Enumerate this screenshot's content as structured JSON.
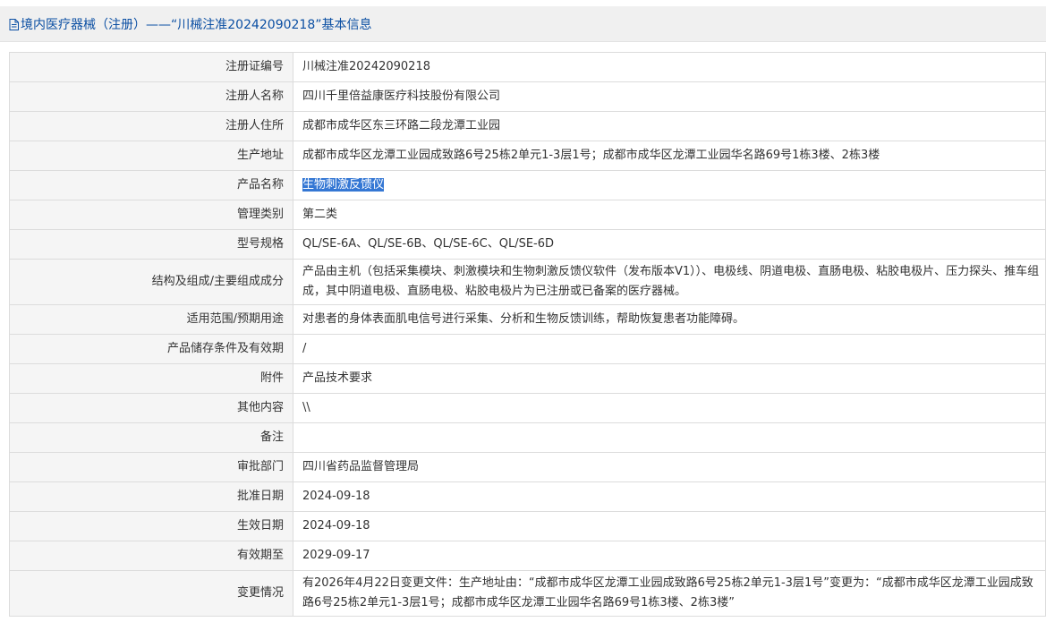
{
  "header": {
    "title": "境内医疗器械（注册）——“川械注准20242090218”基本信息"
  },
  "rows": [
    {
      "label": "注册证编号",
      "value": "川械注准20242090218"
    },
    {
      "label": "注册人名称",
      "value": "四川千里倍益康医疗科技股份有限公司"
    },
    {
      "label": "注册人住所",
      "value": "成都市成华区东三环路二段龙潭工业园"
    },
    {
      "label": "生产地址",
      "value": "成都市成华区龙潭工业园成致路6号25栋2单元1-3层1号；成都市成华区龙潭工业园华名路69号1栋3楼、2栋3楼"
    },
    {
      "label": "产品名称",
      "value": "生物刺激反馈仪",
      "selected": true
    },
    {
      "label": "管理类别",
      "value": "第二类"
    },
    {
      "label": "型号规格",
      "value": "QL/SE-6A、QL/SE-6B、QL/SE-6C、QL/SE-6D"
    },
    {
      "label": "结构及组成/主要组成成分",
      "value": "产品由主机（包括采集模块、刺激模块和生物刺激反馈仪软件（发布版本V1））、电极线、阴道电极、直肠电极、粘胶电极片、压力探头、推车组成，其中阴道电极、直肠电极、粘胶电极片为已注册或已备案的医疗器械。"
    },
    {
      "label": "适用范围/预期用途",
      "value": "对患者的身体表面肌电信号进行采集、分析和生物反馈训练，帮助恢复患者功能障碍。"
    },
    {
      "label": "产品储存条件及有效期",
      "value": "/"
    },
    {
      "label": "附件",
      "value": "产品技术要求"
    },
    {
      "label": "其他内容",
      "value": "\\\\"
    },
    {
      "label": "备注",
      "value": ""
    },
    {
      "label": "审批部门",
      "value": "四川省药品监督管理局"
    },
    {
      "label": "批准日期",
      "value": "2024-09-18"
    },
    {
      "label": "生效日期",
      "value": "2024-09-18"
    },
    {
      "label": "有效期至",
      "value": "2029-09-17"
    },
    {
      "label": "变更情况",
      "value": "有2026年4月22日变更文件：生产地址由：“成都市成华区龙潭工业园成致路6号25栋2单元1-3层1号”变更为：“成都市成华区龙潭工业园成致路6号25栋2单元1-3层1号；成都市成华区龙潭工业园华名路69号1栋3楼、2栋3楼”"
    }
  ],
  "colors": {
    "title": "#0b4fa3",
    "label_bg": "#f5f5f5",
    "selection": "#3477d4"
  },
  "icons": {
    "title_icon": "document-icon"
  }
}
